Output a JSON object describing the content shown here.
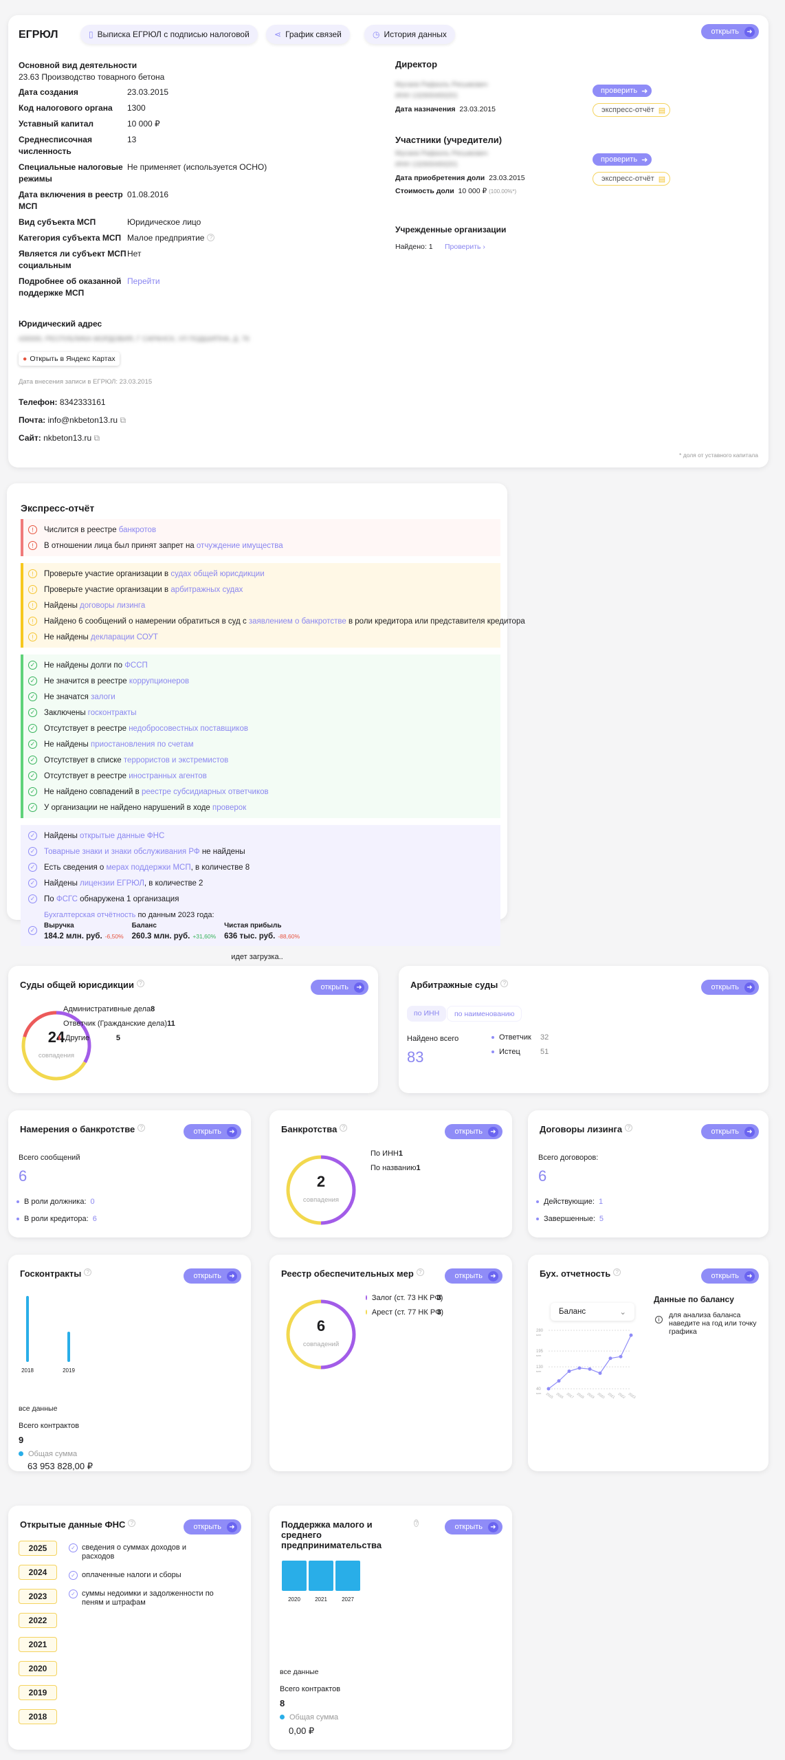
{
  "egrul": {
    "title": "ЕГРЮЛ",
    "buttons": [
      "Выписка ЕГРЮЛ с подписью налоговой",
      "График связей",
      "История данных"
    ],
    "open": "открыть",
    "activity_label": "Основной вид деятельности",
    "activity": "23.63 Производство товарного бетона",
    "fields": [
      {
        "label": "Дата создания",
        "value": "23.03.2015"
      },
      {
        "label": "Код налогового органа",
        "value": "1300"
      },
      {
        "label": "Уставный капитал",
        "value": "10 000 ₽"
      },
      {
        "label": "Среднесписочная численность",
        "value": "13"
      },
      {
        "label": "Специальные налоговые режимы",
        "value": "Не применяет (используется ОСНО)"
      },
      {
        "label": "Дата включения в реестр МСП",
        "value": "01.08.2016"
      },
      {
        "label": "Вид субъекта МСП",
        "value": "Юридическое лицо"
      },
      {
        "label": "Категория субъекта МСП",
        "value": "Малое предприятие"
      },
      {
        "label": "Является ли субъект МСП социальным",
        "value": "Нет"
      },
      {
        "label": "Подробнее об оказанной поддержке МСП",
        "value": "Перейти"
      }
    ],
    "address_label": "Юридический адрес",
    "address": "430000, РЕСПУБЛИКА МОРДОВИЯ, Г САРАНСК, УЛ ПОДШИПНА, Д. 76",
    "map_button": "Открыть в Яндекс Картах",
    "record_date": "Дата внесения записи в ЕГРЮЛ: 23.03.2015",
    "phone_label": "Телефон:",
    "phone": "8342333161",
    "email_label": "Почта:",
    "email": "info@nkbeton13.ru",
    "site_label": "Сайт:",
    "site": "nkbeton13.ru",
    "footnote": "* доля от уставного капитала",
    "director_title": "Директор",
    "director_name": "Мусаев Рафаэль Рясымович",
    "director_inn": "ИНН 132600493201",
    "director_date_label": "Дата назначения",
    "director_date": "23.03.2015",
    "check": "проверить",
    "express": "экспресс-отчёт",
    "founders_title": "Участники (учредители)",
    "founder_name": "Мусаев Рафаэль Рясымович",
    "founder_inn": "ИНН 132600493201",
    "founder_date_label": "Дата приобретения доли",
    "founder_date": "23.03.2015",
    "founder_share_label": "Стоимость доли",
    "founder_share": "10 000 ₽",
    "founder_pct": "(100.00%*)",
    "orgs_title": "Учрежденные организации",
    "orgs_found": "Найдено: 1",
    "orgs_check": "Проверить ›"
  },
  "express": {
    "title": "Экспресс-отчёт",
    "red": [
      {
        "pre": "Числится в реестре ",
        "link": "банкротов",
        "post": ""
      },
      {
        "pre": "В отношении лица был принят запрет на ",
        "link": "отчуждение имущества",
        "post": ""
      }
    ],
    "yellow": [
      {
        "pre": "Проверьте участие организации в ",
        "link": "судах общей юрисдикции",
        "post": ""
      },
      {
        "pre": "Проверьте участие организации в ",
        "link": "арбитражных судах",
        "post": ""
      },
      {
        "pre": "Найдены ",
        "link": "договоры лизинга",
        "post": ""
      },
      {
        "pre": "Найдено 6 сообщений о намерении обратиться в суд с ",
        "link": "заявлением о банкротстве",
        "post": " в роли кредитора или представителя кредитора"
      },
      {
        "pre": "Не найдены ",
        "link": "декларации СОУТ",
        "post": ""
      }
    ],
    "green": [
      {
        "pre": "Не найдены долги по ",
        "link": "ФССП",
        "post": ""
      },
      {
        "pre": "Не значится в реестре ",
        "link": "коррупционеров",
        "post": ""
      },
      {
        "pre": "Не значатся ",
        "link": "залоги",
        "post": ""
      },
      {
        "pre": "Заключены ",
        "link": "госконтракты",
        "post": ""
      },
      {
        "pre": "Отсутствует в реестре ",
        "link": "недобросовестных поставщиков",
        "post": ""
      },
      {
        "pre": "Не найдены ",
        "link": "приостановления по счетам",
        "post": ""
      },
      {
        "pre": "Отсутствует в списке ",
        "link": "террористов и экстремистов",
        "post": ""
      },
      {
        "pre": "Отсутствует в реестре ",
        "link": "иностранных агентов",
        "post": ""
      },
      {
        "pre": "Не найдено совпадений в ",
        "link": "реестре субсидиарных ответчиков",
        "post": ""
      },
      {
        "pre": "У организации не найдено нарушений в ходе ",
        "link": "проверок",
        "post": ""
      }
    ],
    "purple": [
      {
        "pre": "Найдены ",
        "link": "открытые данные ФНС",
        "post": ""
      },
      {
        "pre": "",
        "link": "Товарные знаки и знаки обслуживания РФ",
        "post": " не найдены"
      },
      {
        "pre": "Есть сведения о ",
        "link": "мерах поддержки МСП",
        "post": ", в количестве 8"
      },
      {
        "pre": "Найдены ",
        "link": "лицензии ЕГРЮЛ",
        "post": ", в количестве 2"
      },
      {
        "pre": "По ",
        "link": "ФСГС",
        "post": " обнаружена 1 организация"
      }
    ],
    "fin_link": "Бухгалтерская отчётность",
    "fin_post": " по данным 2023 года:",
    "fin": [
      {
        "label": "Выручка",
        "value": "184.2 млн. руб.",
        "delta": "-6,50%",
        "color": "#e5533d"
      },
      {
        "label": "Баланс",
        "value": "260.3 млн. руб.",
        "delta": "+31,60%",
        "color": "#35b35a"
      },
      {
        "label": "Чистая прибыль",
        "value": "636 тыс. руб.",
        "delta": "-88,60%",
        "color": "#e5533d"
      }
    ],
    "loading": "идет загрузка.."
  },
  "courts": {
    "title": "Суды общей юрисдикции",
    "total": "24",
    "total_label": "совпадения",
    "items": [
      {
        "label": "Административные дела",
        "value": "8",
        "color": "#a25ce8"
      },
      {
        "label": "Ответчик (Гражданские дела)",
        "value": "11",
        "color": "#f2d84e"
      },
      {
        "label": "Другие",
        "value": "5",
        "color": "#ec5a5a"
      }
    ]
  },
  "arbitr": {
    "title": "Арбитражные суды",
    "tabs": [
      "по ИНН",
      "по наименованию"
    ],
    "found_label": "Найдено всего",
    "found": "83",
    "items": [
      {
        "label": "Ответчик",
        "value": "32"
      },
      {
        "label": "Истец",
        "value": "51"
      }
    ]
  },
  "bankrupt_intent": {
    "title": "Намерения о банкротстве",
    "total_label": "Всего сообщений",
    "total": "6",
    "items": [
      {
        "label": "В роли должника:",
        "value": "0"
      },
      {
        "label": "В роли кредитора:",
        "value": "6"
      }
    ]
  },
  "bankrupt": {
    "title": "Банкротства",
    "total": "2",
    "total_label": "совпадения",
    "items": [
      {
        "label": "По ИНН",
        "value": "1",
        "color": "#a25ce8"
      },
      {
        "label": "По названию",
        "value": "1",
        "color": "#f2d84e"
      }
    ]
  },
  "leasing": {
    "title": "Договоры лизинга",
    "total_label": "Всего договоров:",
    "total": "6",
    "items": [
      {
        "label": "Действующие:",
        "value": "1"
      },
      {
        "label": "Завершенные:",
        "value": "5"
      }
    ]
  },
  "gov": {
    "title": "Госконтракты",
    "years": [
      "2018",
      "2019"
    ],
    "bar_values": [
      100,
      46
    ],
    "all": "все данные",
    "count_label": "Всего контрактов",
    "count": "9",
    "sum_label": "Общая сумма",
    "sum": "63 953 828,00 ₽"
  },
  "security": {
    "title": "Реестр обеспечительных мер",
    "total": "6",
    "total_label": "совпадений",
    "items": [
      {
        "label": "Залог (ст. 73 НК РФ)",
        "value": "3",
        "color": "#a25ce8"
      },
      {
        "label": "Арест (ст. 77 НК РФ)",
        "value": "3",
        "color": "#f2d84e"
      }
    ]
  },
  "accounting": {
    "title": "Бух. отчетность",
    "select": "Баланс",
    "side_title": "Данные по балансу",
    "hint": "для анализа баланса наведите на год или точку графика"
  },
  "chart_data": {
    "type": "line",
    "title": "Баланс",
    "x": [
      "2015",
      "2016",
      "2017",
      "2018",
      "2019",
      "2020",
      "2021",
      "2022",
      "2023"
    ],
    "values": [
      40,
      72,
      112,
      125,
      121,
      104,
      165,
      172,
      260
    ],
    "yticks": [
      "40",
      "130",
      "195",
      "280"
    ],
    "yunit": "млн",
    "ylim": [
      40,
      280
    ]
  },
  "fns": {
    "title": "Открытые данные ФНС",
    "years": [
      "2025",
      "2024",
      "2023",
      "2022",
      "2021",
      "2020",
      "2019",
      "2018"
    ],
    "items": [
      "сведения о суммах доходов и расходов",
      "оплаченные налоги и сборы",
      "суммы недоимки и задолженности по пеням и штрафам"
    ]
  },
  "sme": {
    "title": "Поддержка малого и среднего предпринимательства",
    "years": [
      "2020",
      "2021",
      "2027"
    ],
    "bar_values": [
      1,
      1,
      1
    ],
    "all": "все данные",
    "count_label": "Всего контрактов",
    "count": "8",
    "sum_label": "Общая сумма",
    "sum": "0,00 ₽"
  },
  "colors": {
    "accent": "#8f8cf7",
    "bar": "#29aee8"
  }
}
